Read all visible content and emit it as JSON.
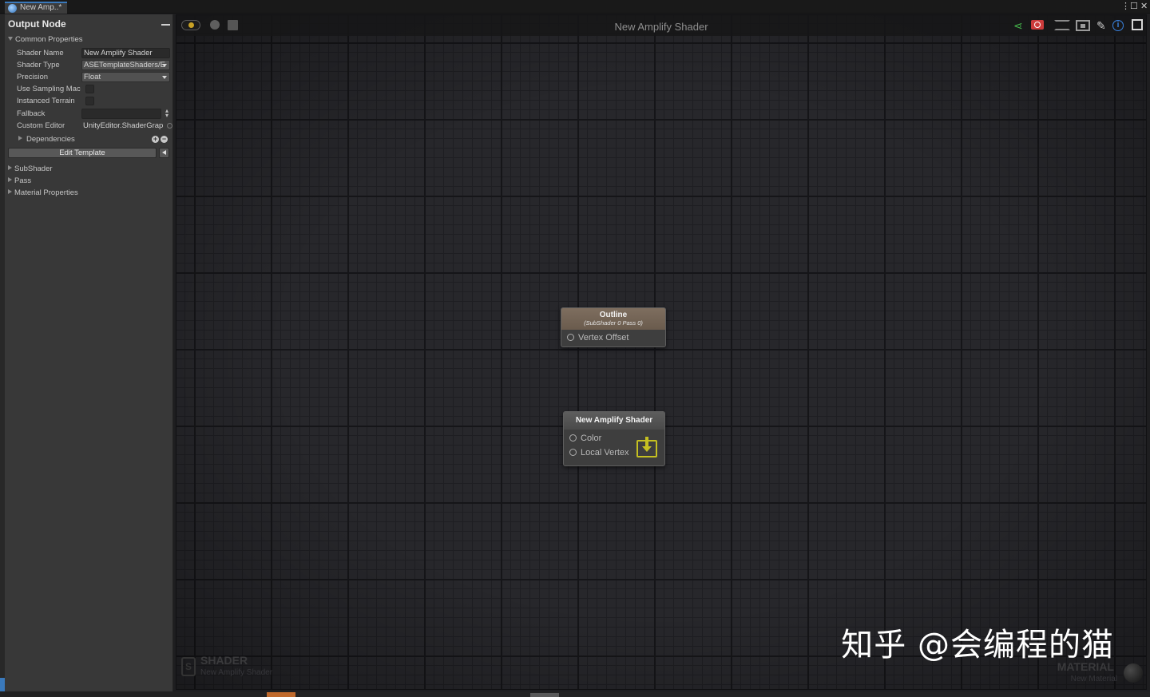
{
  "window": {
    "tab_title": "New Amp..*",
    "menu_glyph": "⋮",
    "max_glyph": "☐",
    "close_glyph": "✕"
  },
  "panel": {
    "title": "Output Node",
    "common_properties_label": "Common Properties",
    "fields": {
      "shader_name_label": "Shader Name",
      "shader_name_value": "New Amplify Shader",
      "shader_type_label": "Shader Type",
      "shader_type_value": "ASETemplateShaders/E",
      "precision_label": "Precision",
      "precision_value": "Float",
      "use_sampling_label": "Use Sampling Mac",
      "instanced_terrain_label": "Instanced Terrain",
      "fallback_label": "Fallback",
      "custom_editor_label": "Custom Editor",
      "custom_editor_value": "UnityEditor.ShaderGrap"
    },
    "dependencies_label": "Dependencies",
    "edit_template_label": "Edit Template",
    "sections": [
      "SubShader",
      "Pass",
      "Material Properties"
    ]
  },
  "canvas": {
    "title": "New Amplify Shader",
    "nodes": [
      {
        "title": "Outline",
        "subtitle": "(SubShader 0 Pass 0)",
        "ports": [
          "Vertex Offset"
        ]
      },
      {
        "title": "New Amplify Shader",
        "ports": [
          "Color",
          "Local Vertex"
        ]
      }
    ],
    "corner_left": {
      "icon_letter": "S",
      "big": "SHADER",
      "small": "New Amplify Shader"
    },
    "corner_right": {
      "big": "MATERIAL",
      "small": "New Material"
    },
    "watermark": "知乎 @会编程的猫"
  },
  "colors": {
    "accent": "#3a79bb",
    "node_header": "#75665a",
    "master_icon": "#c5c021",
    "share_icon": "#44b44a",
    "camera_icon": "#cc3b3b",
    "info_icon": "#3a83e0"
  },
  "icons": [
    "live-toggle-icon",
    "record-icon",
    "save-icon",
    "share-icon",
    "camera-icon",
    "focus-icon",
    "maximize-graph-icon",
    "tools-icon",
    "info-icon",
    "maximize-icon",
    "master-node-icon"
  ]
}
